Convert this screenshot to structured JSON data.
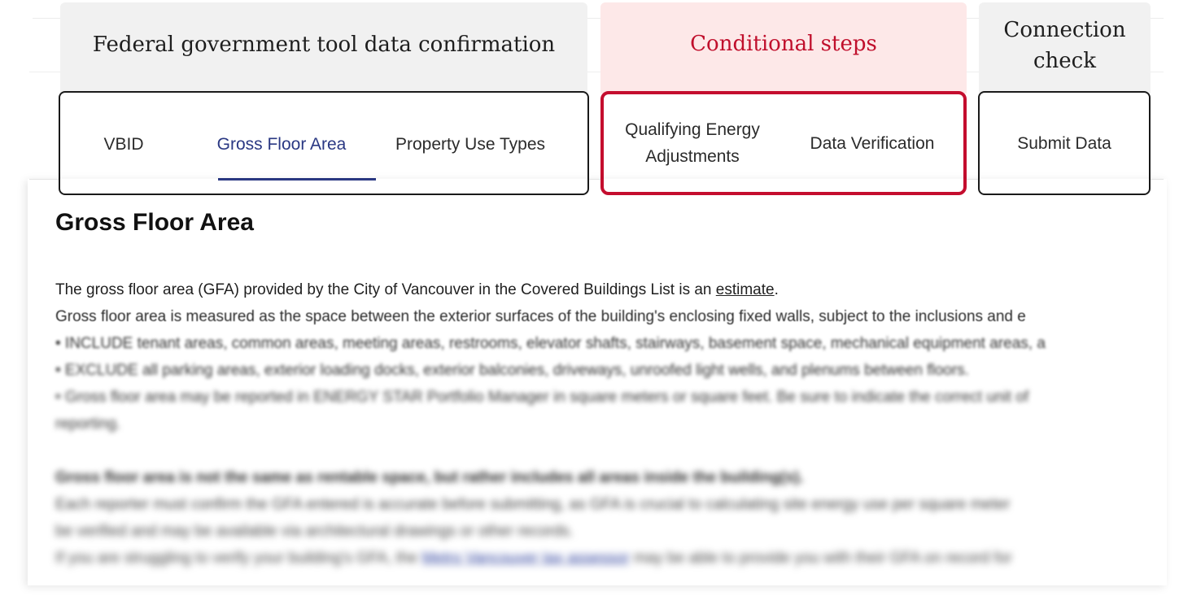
{
  "groups": {
    "federal": {
      "label": "Federal government tool data confirmation",
      "tabs": [
        {
          "label": "VBID"
        },
        {
          "label": "Gross Floor Area",
          "active": true
        },
        {
          "label": "Property Use Types"
        }
      ]
    },
    "conditional": {
      "label": "Conditional steps",
      "tabs": [
        {
          "label": "Qualifying Energy Adjustments"
        },
        {
          "label": "Data Verification"
        }
      ]
    },
    "connection": {
      "label": "Connection check",
      "tabs": [
        {
          "label": "Submit Data"
        }
      ]
    }
  },
  "content": {
    "title": "Gross Floor Area",
    "intro_before_link": "The gross floor area (GFA) provided by the City of Vancouver in the Covered Buildings List is an ",
    "intro_link": "estimate",
    "intro_after_link": ".",
    "definition": "Gross floor area is measured as the space between the exterior surfaces of the building's enclosing fixed walls, subject to the inclusions and e",
    "include": "• INCLUDE tenant areas, common areas, meeting areas, restrooms, elevator shafts, stairways, basement space, mechanical equipment areas, a",
    "exclude": "• EXCLUDE all parking areas, exterior loading docks, exterior balconies, driveways, unroofed light wells, and plenums between floors.",
    "units_line1": "• Gross floor area may be reported in ENERGY STAR Portfolio Manager in square meters or square feet. Be sure to indicate the correct unit of",
    "units_line2": "reporting.",
    "bold_note": "Gross floor area is not the same as rentable space, but rather includes all areas inside the building(s).",
    "confirm_line1": "Each reporter must confirm the GFA entered is accurate before submitting, as GFA is crucial to calculating site energy use per square meter",
    "confirm_line2": "be verified and may be available via architectural drawings or other records.",
    "help_before_link": "If you are struggling to verify your building's GFA, the ",
    "help_link": "Metro Vancouver tax assessor",
    "help_after_link": " may be able to provide you with their GFA on record for"
  }
}
